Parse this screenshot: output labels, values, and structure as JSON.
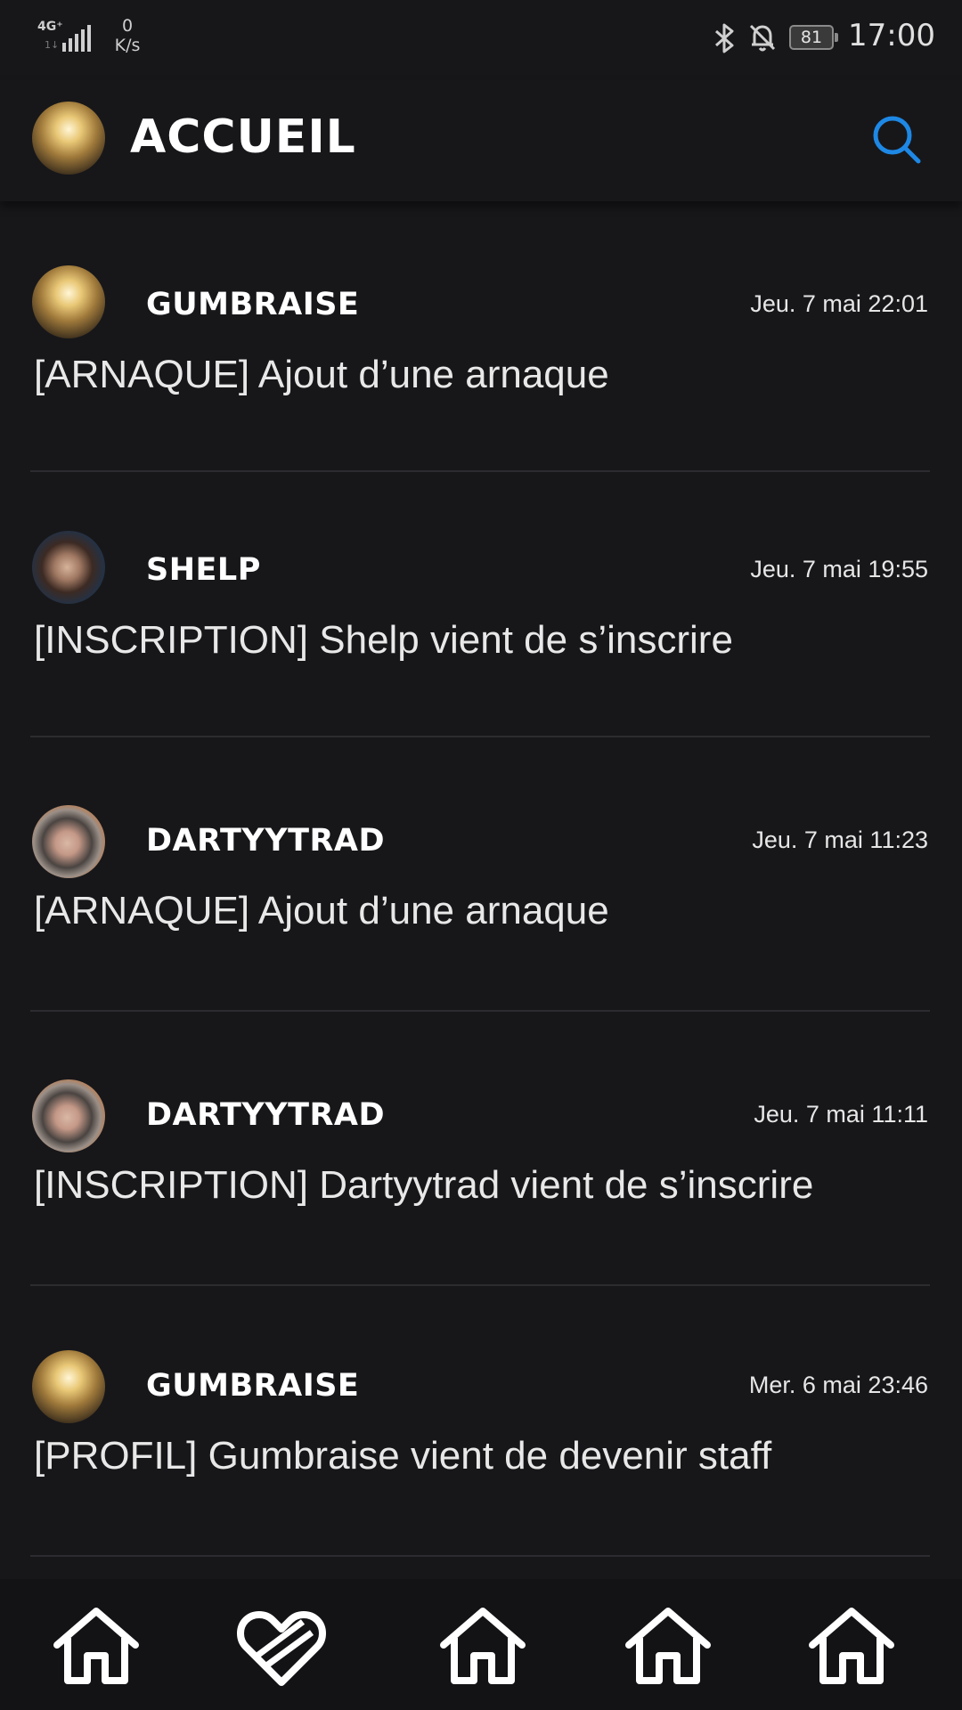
{
  "status_bar": {
    "network_type": "4G⁺",
    "network_sub": "1↓",
    "speed_value": "0",
    "speed_unit": "K/s",
    "battery_level": "81",
    "time": "17:00"
  },
  "header": {
    "title": "ACCUEIL",
    "avatar_icon": "profile-avatar",
    "search_icon": "search-icon",
    "accent_color": "#1e88e5"
  },
  "feed": [
    {
      "user": "GUMBRAISE",
      "time": "Jeu. 7 mai 22:01",
      "message": "[ARNAQUE] Ajout d’une arnaque"
    },
    {
      "user": "SHELP",
      "time": "Jeu. 7 mai 19:55",
      "message": "[INSCRIPTION] Shelp vient de s’inscrire"
    },
    {
      "user": "DARTYYTRAD",
      "time": "Jeu. 7 mai 11:23",
      "message": "[ARNAQUE] Ajout d’une arnaque"
    },
    {
      "user": "DARTYYTRAD",
      "time": "Jeu. 7 mai 11:11",
      "message": "[INSCRIPTION] Dartyytrad vient de s’inscrire"
    },
    {
      "user": "GUMBRAISE",
      "time": "Mer. 6 mai 23:46",
      "message": "[PROFIL] Gumbraise vient de devenir staff"
    }
  ],
  "bottom_nav": {
    "items": [
      "home-icon",
      "heart-icon",
      "home-icon",
      "home-icon",
      "home-icon"
    ]
  }
}
